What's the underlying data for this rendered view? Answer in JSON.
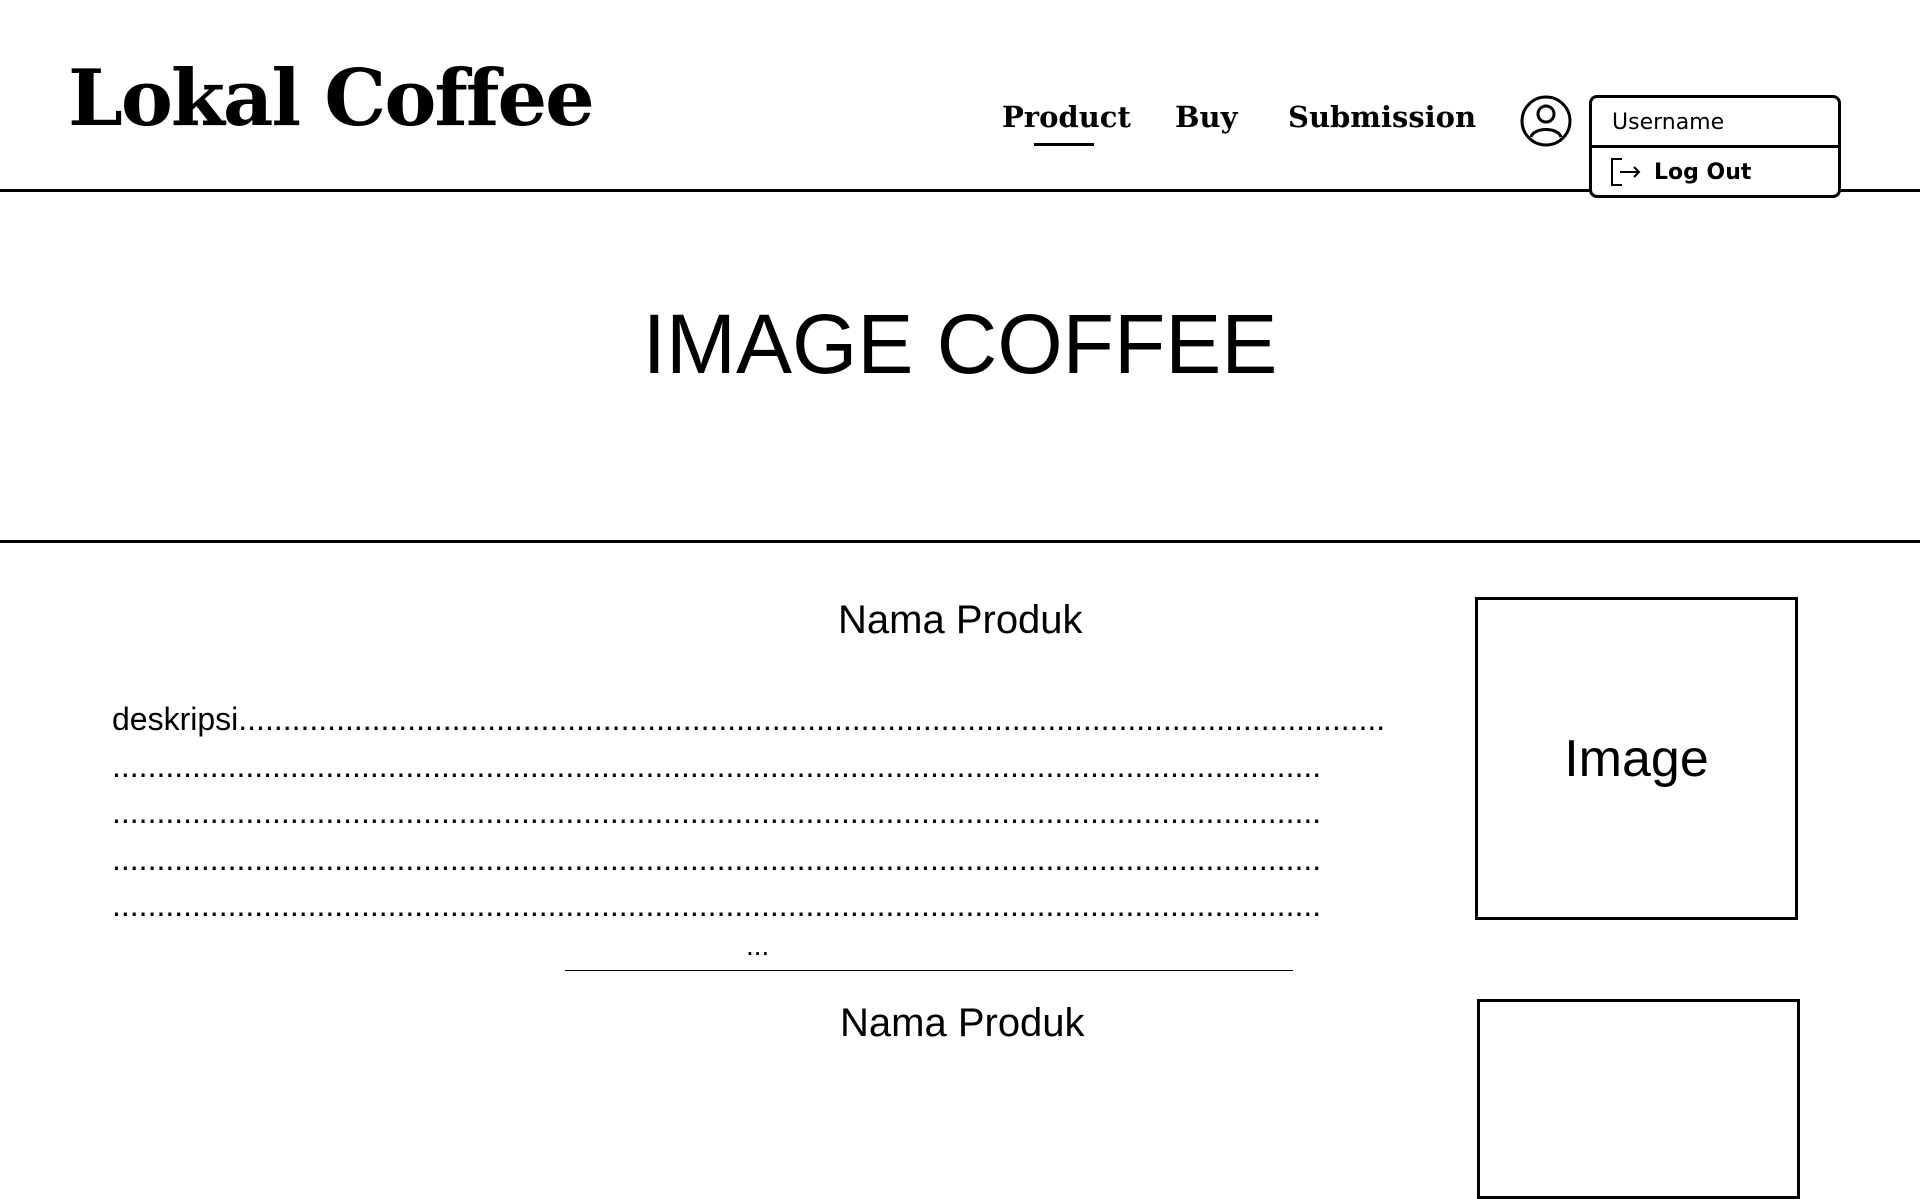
{
  "header": {
    "logo": "Lokal Coffee",
    "nav": {
      "product": "Product",
      "buy": "Buy",
      "submission": "Submission"
    },
    "user_menu": {
      "username": "Username",
      "logout": "Log Out",
      "icon": "user-circle-icon",
      "logout_icon": "logout-icon"
    }
  },
  "hero": {
    "text": "IMAGE COFFEE"
  },
  "products": [
    {
      "title": "Nama Produk",
      "description": "deskripsi.................................................................................................................................\n........................................................................................................................................\n........................................................................................................................................\n........................................................................................................................................\n........................................................................................................................................",
      "more": "...",
      "image_label": "Image"
    },
    {
      "title": "Nama Produk"
    }
  ]
}
